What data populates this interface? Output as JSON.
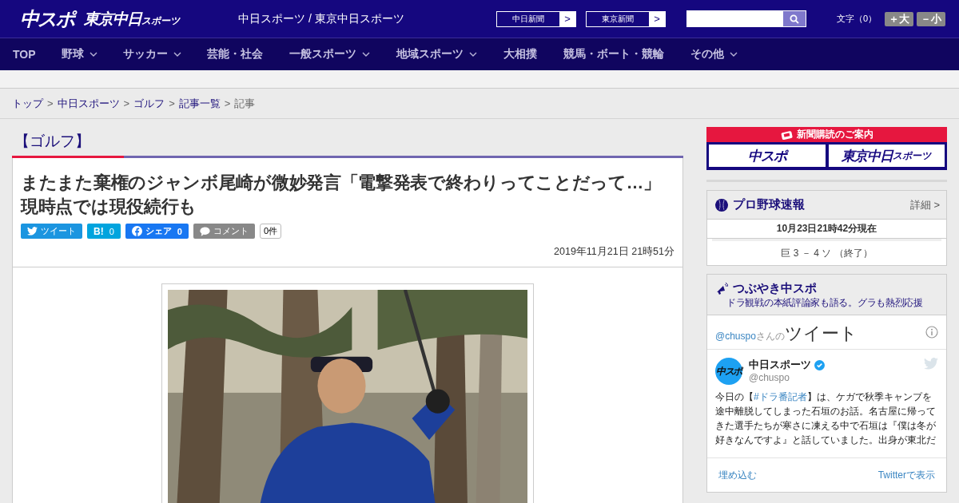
{
  "header": {
    "logo_main": "中スポ",
    "logo_sub": "東京中日",
    "logo_sub_small": "スポーツ",
    "site_title": "中日スポーツ / 東京中日スポーツ",
    "paper_links": [
      {
        "label": "中日新聞",
        "arrow": ">"
      },
      {
        "label": "東京新聞",
        "arrow": ">"
      }
    ],
    "font_size": {
      "label": "文字（0）",
      "buttons": [
        "＋大",
        "－小"
      ]
    }
  },
  "nav": [
    {
      "label": "TOP",
      "dropdown": false
    },
    {
      "label": "野球",
      "dropdown": true
    },
    {
      "label": "サッカー",
      "dropdown": true
    },
    {
      "label": "芸能・社会",
      "dropdown": false
    },
    {
      "label": "一般スポーツ",
      "dropdown": true
    },
    {
      "label": "地域スポーツ",
      "dropdown": true
    },
    {
      "label": "大相撲",
      "dropdown": false
    },
    {
      "label": "競馬・ボート・競輪",
      "dropdown": false
    },
    {
      "label": "その他",
      "dropdown": true
    }
  ],
  "breadcrumb": [
    {
      "label": "トップ",
      "link": true,
      "sep": ">"
    },
    {
      "label": "中日スポーツ",
      "link": true,
      "sep": ">"
    },
    {
      "label": "ゴルフ",
      "link": true,
      "sep": ">"
    },
    {
      "label": "記事一覧",
      "link": true,
      "sep": ">"
    },
    {
      "label": "記事",
      "link": false
    }
  ],
  "article": {
    "category": "【ゴルフ】",
    "title_lines": [
      "またまた棄権のジャンボ尾崎が微妙発言「電撃発表で終わりってことだって…」",
      "現時点では現役続行も"
    ],
    "share": [
      {
        "kind": "twitter",
        "label": "ツイート"
      },
      {
        "kind": "hatena",
        "label": "B!",
        "count": "0"
      },
      {
        "kind": "facebook",
        "label": "シェア",
        "count": "0"
      },
      {
        "kind": "comment",
        "label": "コメント"
      }
    ],
    "comment_count": "0件",
    "date": "2019年11月21日 21時51分"
  },
  "sidebar": {
    "subscribe": {
      "title": "新聞購読のご案内",
      "logo_main": "中スポ",
      "logo_sub": "東京中日",
      "logo_sub_small": "スポーツ"
    },
    "baseball": {
      "title": "プロ野球速報",
      "detail": "詳細 >",
      "time": "10月23日21時42分現在",
      "score": "巨 3 － 4 ソ （終了）"
    },
    "tweets": {
      "title": "つぶやき中スポ",
      "subtitle": "ドラ観戦の本紙評論家も語る。グラも熱烈応援",
      "handle_link": "@chuspo",
      "handle_suffix": "さんの",
      "heading": "ツイート",
      "tweet": {
        "name": "中日スポーツ",
        "verified": true,
        "handle": "@chuspo",
        "avatar": "中スポ",
        "text_before": "今日の【",
        "hashtag": "#ドラ番記者",
        "text_after": "】は、ケガで秋季キャンプを途中離脱してしまった石垣のお話。名古屋に帰ってきた選手たちが寒さに凍える中で石垣は『僕は冬が好きなんですよ』と話していました。出身が東北だ"
      },
      "footer_links": [
        "埋め込む",
        "Twitterで表示"
      ]
    }
  }
}
